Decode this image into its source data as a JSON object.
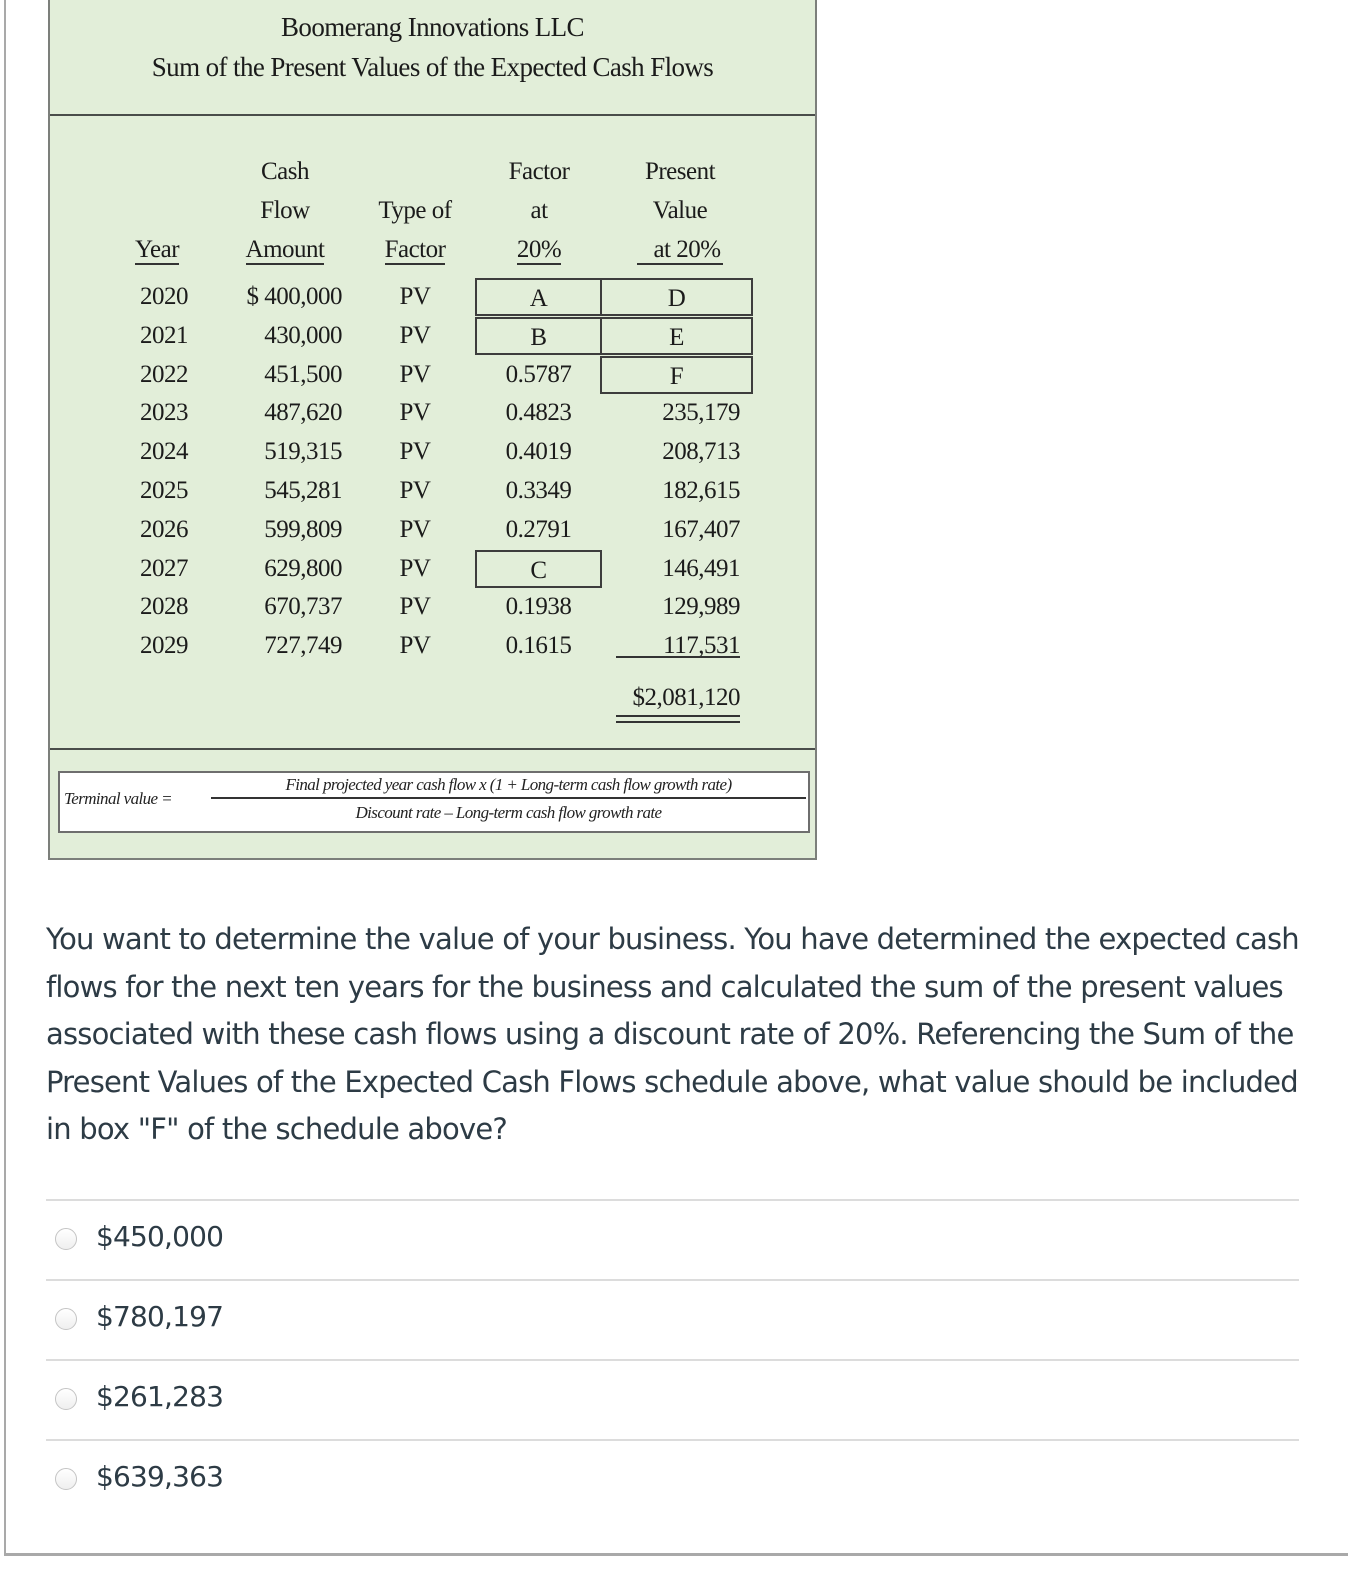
{
  "schedule": {
    "company": "Boomerang Innovations LLC",
    "title": "Sum of the Present Values of the Expected Cash Flows",
    "headers": {
      "year": [
        "Year"
      ],
      "amount": [
        "Cash",
        "Flow",
        "Amount"
      ],
      "type": [
        "Type of",
        "Factor"
      ],
      "factor": [
        "Factor",
        "at",
        "20%"
      ],
      "pv": [
        "Present",
        "Value",
        "at 20%"
      ]
    },
    "rows": [
      {
        "year": "2020",
        "amount": "$ 400,000",
        "type": "PV",
        "factor": "A",
        "pv": "D"
      },
      {
        "year": "2021",
        "amount": "430,000",
        "type": "PV",
        "factor": "B",
        "pv": "E"
      },
      {
        "year": "2022",
        "amount": "451,500",
        "type": "PV",
        "factor": "0.5787",
        "pv": "F"
      },
      {
        "year": "2023",
        "amount": "487,620",
        "type": "PV",
        "factor": "0.4823",
        "pv": "235,179"
      },
      {
        "year": "2024",
        "amount": "519,315",
        "type": "PV",
        "factor": "0.4019",
        "pv": "208,713"
      },
      {
        "year": "2025",
        "amount": "545,281",
        "type": "PV",
        "factor": "0.3349",
        "pv": "182,615"
      },
      {
        "year": "2026",
        "amount": "599,809",
        "type": "PV",
        "factor": "0.2791",
        "pv": "167,407"
      },
      {
        "year": "2027",
        "amount": "629,800",
        "type": "PV",
        "factor": "C",
        "pv": "146,491"
      },
      {
        "year": "2028",
        "amount": "670,737",
        "type": "PV",
        "factor": "0.1938",
        "pv": "129,989"
      },
      {
        "year": "2029",
        "amount": "727,749",
        "type": "PV",
        "factor": "0.1615",
        "pv": "117,531"
      }
    ],
    "total": "$2,081,120",
    "formula": {
      "label": "Terminal value =",
      "numerator": "Final projected year cash flow x (1 + Long-term cash flow growth rate)",
      "denominator": "Discount rate – Long-term cash flow growth rate"
    }
  },
  "question": "You want to determine the value of your business. You have determined the expected cash flows for the next ten years for the business and calculated the sum of the present values associated with these cash flows using a discount rate of 20%. Referencing the Sum of the Present Values of the Expected Cash Flows schedule above, what value should be included in box \"F\" of the schedule above?",
  "answers": [
    {
      "label": "$450,000",
      "selected": false
    },
    {
      "label": "$780,197",
      "selected": false
    },
    {
      "label": "$261,283",
      "selected": false
    },
    {
      "label": "$639,363",
      "selected": false
    }
  ]
}
